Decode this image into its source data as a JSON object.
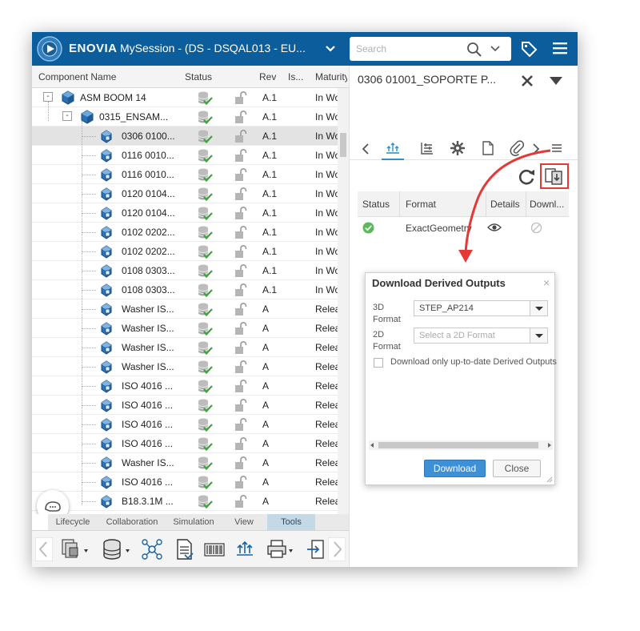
{
  "header": {
    "brand": "ENOVIA",
    "session_title": "MySession - (DS - DSQAL013 - EU...",
    "search_placeholder": "Search"
  },
  "grid": {
    "columns": [
      "Component Name",
      "Status",
      "Rev",
      "Is...",
      "Maturity"
    ],
    "rows": [
      {
        "name": "ASM BOOM 14",
        "rev": "A.1",
        "maturity": "In Work",
        "level": 0,
        "type": "assembly",
        "expander": "-"
      },
      {
        "name": "0315_ENSAM...",
        "rev": "A.1",
        "maturity": "In Work",
        "level": 1,
        "type": "assembly",
        "expander": "-"
      },
      {
        "name": "0306 0100...",
        "rev": "A.1",
        "maturity": "In Work",
        "level": 2,
        "type": "part",
        "selected": true
      },
      {
        "name": "0116 0010...",
        "rev": "A.1",
        "maturity": "In Work",
        "level": 2,
        "type": "part"
      },
      {
        "name": "0116 0010...",
        "rev": "A.1",
        "maturity": "In Work",
        "level": 2,
        "type": "part"
      },
      {
        "name": "0120 0104...",
        "rev": "A.1",
        "maturity": "In Work",
        "level": 2,
        "type": "part"
      },
      {
        "name": "0120 0104...",
        "rev": "A.1",
        "maturity": "In Work",
        "level": 2,
        "type": "part"
      },
      {
        "name": "0102 0202...",
        "rev": "A.1",
        "maturity": "In Work",
        "level": 2,
        "type": "part"
      },
      {
        "name": "0102 0202...",
        "rev": "A.1",
        "maturity": "In Work",
        "level": 2,
        "type": "part"
      },
      {
        "name": "0108 0303...",
        "rev": "A.1",
        "maturity": "In Work",
        "level": 2,
        "type": "part"
      },
      {
        "name": "0108 0303...",
        "rev": "A.1",
        "maturity": "In Work",
        "level": 2,
        "type": "part"
      },
      {
        "name": "Washer IS...",
        "rev": "A",
        "maturity": "Released",
        "level": 2,
        "type": "part"
      },
      {
        "name": "Washer IS...",
        "rev": "A",
        "maturity": "Released",
        "level": 2,
        "type": "part"
      },
      {
        "name": "Washer IS...",
        "rev": "A",
        "maturity": "Released",
        "level": 2,
        "type": "part"
      },
      {
        "name": "Washer IS...",
        "rev": "A",
        "maturity": "Released",
        "level": 2,
        "type": "part"
      },
      {
        "name": "ISO 4016 ...",
        "rev": "A",
        "maturity": "Released",
        "level": 2,
        "type": "part"
      },
      {
        "name": "ISO 4016 ...",
        "rev": "A",
        "maturity": "Released",
        "level": 2,
        "type": "part"
      },
      {
        "name": "ISO 4016 ...",
        "rev": "A",
        "maturity": "Released",
        "level": 2,
        "type": "part"
      },
      {
        "name": "ISO 4016 ...",
        "rev": "A",
        "maturity": "Released",
        "level": 2,
        "type": "part"
      },
      {
        "name": "Washer IS...",
        "rev": "A",
        "maturity": "Released",
        "level": 2,
        "type": "part"
      },
      {
        "name": "ISO 4016 ...",
        "rev": "A",
        "maturity": "Released",
        "level": 2,
        "type": "part"
      },
      {
        "name": "B18.3.1M ...",
        "rev": "A",
        "maturity": "Released",
        "level": 2,
        "type": "part"
      }
    ]
  },
  "tools_tabs": [
    "Lifecycle",
    "Collaboration",
    "Simulation",
    "View",
    "Tools"
  ],
  "active_tools_tab": "Tools",
  "right_panel": {
    "title": "0306 01001_SOPORTE P...",
    "table_columns": [
      "Status",
      "Format",
      "Details",
      "Downl..."
    ],
    "table_rows": [
      {
        "format": "ExactGeometry"
      }
    ]
  },
  "dialog": {
    "title": "Download Derived Outputs",
    "label_3d": "3D Format",
    "value_3d": "STEP_AP214",
    "label_2d": "2D Format",
    "placeholder_2d": "Select a 2D Format",
    "checkbox_label": "Download only up-to-date Derived Outputs",
    "download_label": "Download",
    "close_label": "Close"
  },
  "colors": {
    "topbar": "#0b5e9b",
    "accent": "#368ec4",
    "highlight": "#e53935",
    "status_ok": "#5cb85c"
  }
}
